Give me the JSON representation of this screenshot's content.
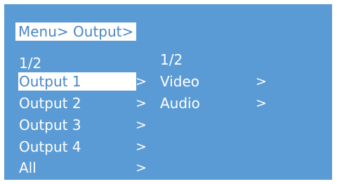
{
  "breadcrumb": "Menu> Output>",
  "left_menu": {
    "page": "1/2",
    "items": [
      {
        "label": "Output 1",
        "arrow": ">",
        "selected": true
      },
      {
        "label": "Output 2",
        "arrow": ">",
        "selected": false
      },
      {
        "label": "Output 3",
        "arrow": ">",
        "selected": false
      },
      {
        "label": "Output 4",
        "arrow": ">",
        "selected": false
      },
      {
        "label": "All",
        "arrow": ">",
        "selected": false
      }
    ]
  },
  "right_menu": {
    "page": "1/2",
    "items": [
      {
        "label": "Video",
        "arrow": ">"
      },
      {
        "label": "Audio",
        "arrow": ">"
      }
    ]
  },
  "colors": {
    "background": "#5b9bd5",
    "highlight": "#ffffff",
    "text": "#ffffff",
    "highlight_text": "#4a86c5"
  }
}
